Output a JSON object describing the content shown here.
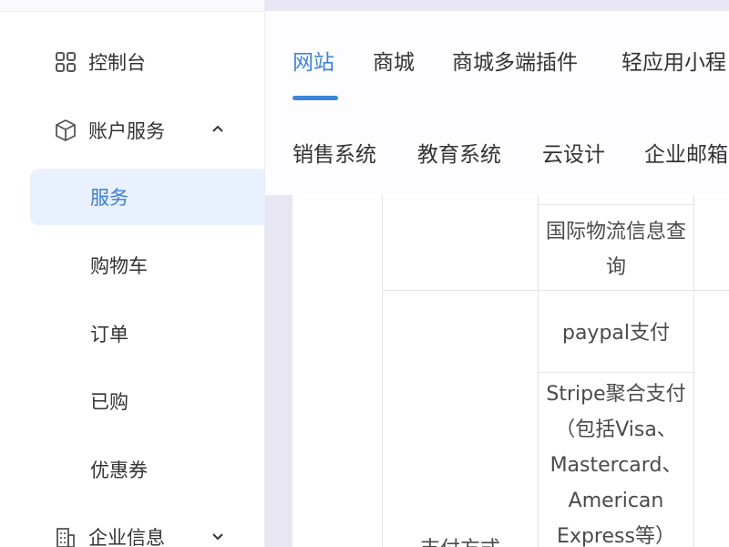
{
  "sidebar": {
    "items": [
      {
        "label": "控制台",
        "icon": "grid-icon"
      },
      {
        "label": "账户服务",
        "icon": "box-icon",
        "expand": "chevron-up-icon"
      },
      {
        "label": "服务"
      },
      {
        "label": "购物车"
      },
      {
        "label": "订单"
      },
      {
        "label": "已购"
      },
      {
        "label": "优惠券"
      },
      {
        "label": "企业信息",
        "icon": "building-icon",
        "expand": "chevron-down-icon"
      }
    ]
  },
  "topnav": {
    "row1": [
      "网站",
      "商城",
      "商城多端插件",
      "轻应用小程"
    ],
    "row2": [
      "销售系统",
      "教育系统",
      "云设计",
      "企业邮箱"
    ]
  },
  "table": {
    "row_logistics": "国际物流信息查询",
    "row_paypal": "paypal支付",
    "row_stripe_lines": [
      "Stripe聚合支付",
      "（包括Visa、",
      "Mastercard、",
      "American",
      "Express等）"
    ],
    "category_payment": "支付方式"
  },
  "colors": {
    "accent": "#3b86d8",
    "active_bg": "#e9f0fe"
  }
}
